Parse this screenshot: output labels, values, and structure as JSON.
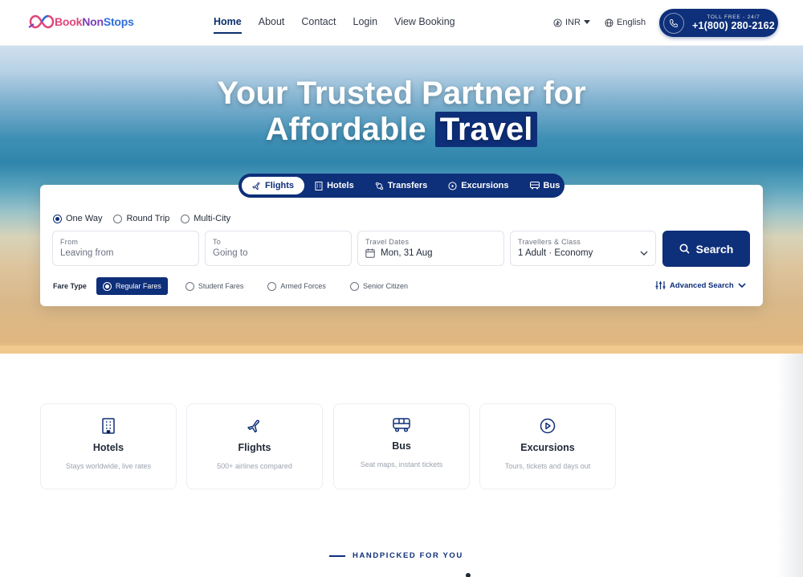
{
  "brand": {
    "name_part1": "Book",
    "name_part2": "Non",
    "name_part3": "Stops"
  },
  "nav": {
    "items": [
      "Home",
      "About",
      "Contact",
      "Login",
      "View Booking"
    ],
    "currency": "INR",
    "language": "English",
    "phone_caption": "TOLL FREE - 24/7",
    "phone_number": "+1(800) 280-2162"
  },
  "hero": {
    "title_line1": "Your Trusted Partner for",
    "title_line2_plain": "Affordable",
    "title_line2_highlight": "Travel"
  },
  "tabs": [
    {
      "label": "Flights",
      "icon": "plane-icon",
      "active": true
    },
    {
      "label": "Hotels",
      "icon": "building-icon",
      "active": false
    },
    {
      "label": "Transfers",
      "icon": "transfer-icon",
      "active": false
    },
    {
      "label": "Excursions",
      "icon": "play-circle-icon",
      "active": false
    },
    {
      "label": "Bus",
      "icon": "bus-icon",
      "active": false
    }
  ],
  "search": {
    "trip_types": [
      "One Way",
      "Round Trip",
      "Multi-City"
    ],
    "selected_trip": "One Way",
    "from_label": "From",
    "from_placeholder": "Leaving from",
    "to_label": "To",
    "to_placeholder": "Going to",
    "dates_label": "Travel Dates",
    "dates_value": "Mon, 31 Aug",
    "travellers_label": "Travellers & Class",
    "travellers_value": "1 Adult · Economy",
    "search_label": "Search",
    "fare_type_label": "Fare Type",
    "fare_types": [
      "Regular Fares",
      "Student Fares",
      "Armed Forces",
      "Senior Citizen"
    ],
    "selected_fare": "Regular Fares",
    "advanced_label": "Advanced Search"
  },
  "services": [
    {
      "title": "Hotels",
      "subtitle": "Stays worldwide, live rates",
      "icon": "building-icon"
    },
    {
      "title": "Flights",
      "subtitle": "500+ airlines compared",
      "icon": "plane-icon"
    },
    {
      "title": "Bus",
      "subtitle": "Seat maps, instant tickets",
      "icon": "bus-icon"
    },
    {
      "title": "Excursions",
      "subtitle": "Tours, tickets and days out",
      "icon": "play-circle-icon"
    }
  ],
  "section": {
    "handpicked_label": "HANDPICKED FOR YOU"
  },
  "colors": {
    "primary": "#0e2f79",
    "text": "#1f2937",
    "muted": "#9ca3af"
  }
}
